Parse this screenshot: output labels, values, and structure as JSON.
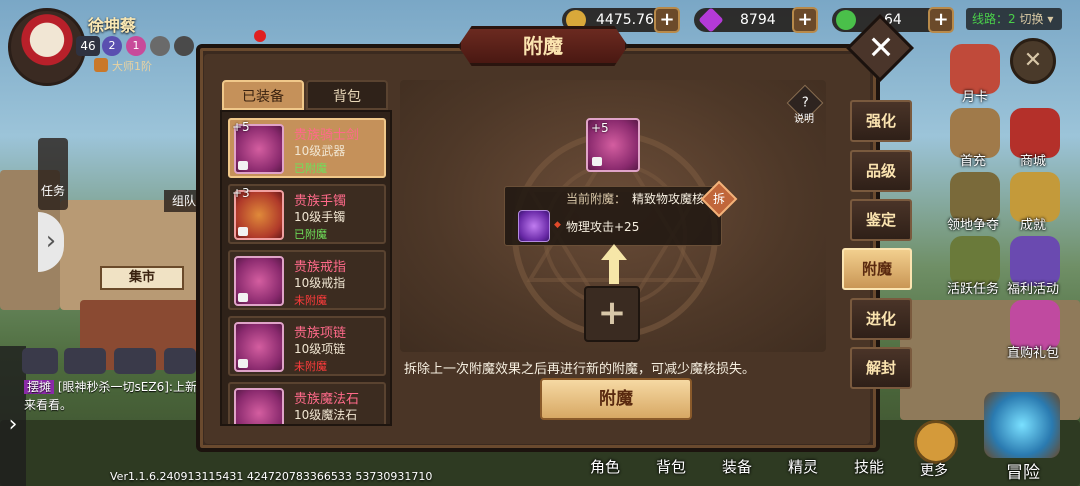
{
  "player": {
    "name": "徐坤蔡",
    "level": "46",
    "rank": "大师1阶",
    "badge1": "2",
    "badge2": "1"
  },
  "currency": {
    "gold": "4475.76万",
    "gems": "8794",
    "stamina": "64"
  },
  "server": {
    "label": "线路：2",
    "action": "切换"
  },
  "panel": {
    "title": "附魔",
    "tabs": [
      "已装备",
      "背包"
    ],
    "items": [
      {
        "plus": "+5",
        "name": "贵族骑士剑",
        "level": "10级武器",
        "status": "已附魔",
        "enchanted": true
      },
      {
        "plus": "+3",
        "name": "贵族手镯",
        "level": "10级手镯",
        "status": "已附魔",
        "enchanted": true
      },
      {
        "plus": "",
        "name": "贵族戒指",
        "level": "10级戒指",
        "status": "未附魔",
        "enchanted": false
      },
      {
        "plus": "",
        "name": "贵族项链",
        "level": "10级项链",
        "status": "未附魔",
        "enchanted": false
      },
      {
        "plus": "",
        "name": "贵族魔法石",
        "level": "10级魔法石",
        "status": "",
        "enchanted": false
      }
    ],
    "selected_plus": "+5",
    "current_label": "当前附魔：",
    "current_value": "精致物攻魔核",
    "remove_label": "拆",
    "stat": "物理攻击+25",
    "help_label": "说明",
    "help_icon": "?",
    "add_symbol": "+",
    "hint": "拆除上一次附魔效果之后再进行新的附魔，可减少魔核损失。",
    "button": "附魔",
    "side_tabs": [
      "强化",
      "品级",
      "鉴定",
      "附魔",
      "进化",
      "解封"
    ]
  },
  "right_icons": [
    "月卡",
    "首充",
    "商城",
    "领地争夺",
    "成就",
    "活跃任务",
    "福利活动",
    "直购礼包"
  ],
  "left": {
    "task": "任务",
    "team": "组队",
    "market": "集市",
    "chat_tag": "摆摊",
    "chat_text": "[眼神秒杀一切sEZ6]:上新",
    "chat_text2": "来看看。"
  },
  "bottom_nav": [
    "角色",
    "背包",
    "装备",
    "精灵",
    "技能",
    "更多",
    "冒险"
  ],
  "version": "Ver1.1.6.240913115431   424720783366533   53730931710",
  "colors": {
    "enchanted": "#6fe05a",
    "not_enchanted": "#ff3b3b",
    "item_name": "#ff6a8a"
  }
}
